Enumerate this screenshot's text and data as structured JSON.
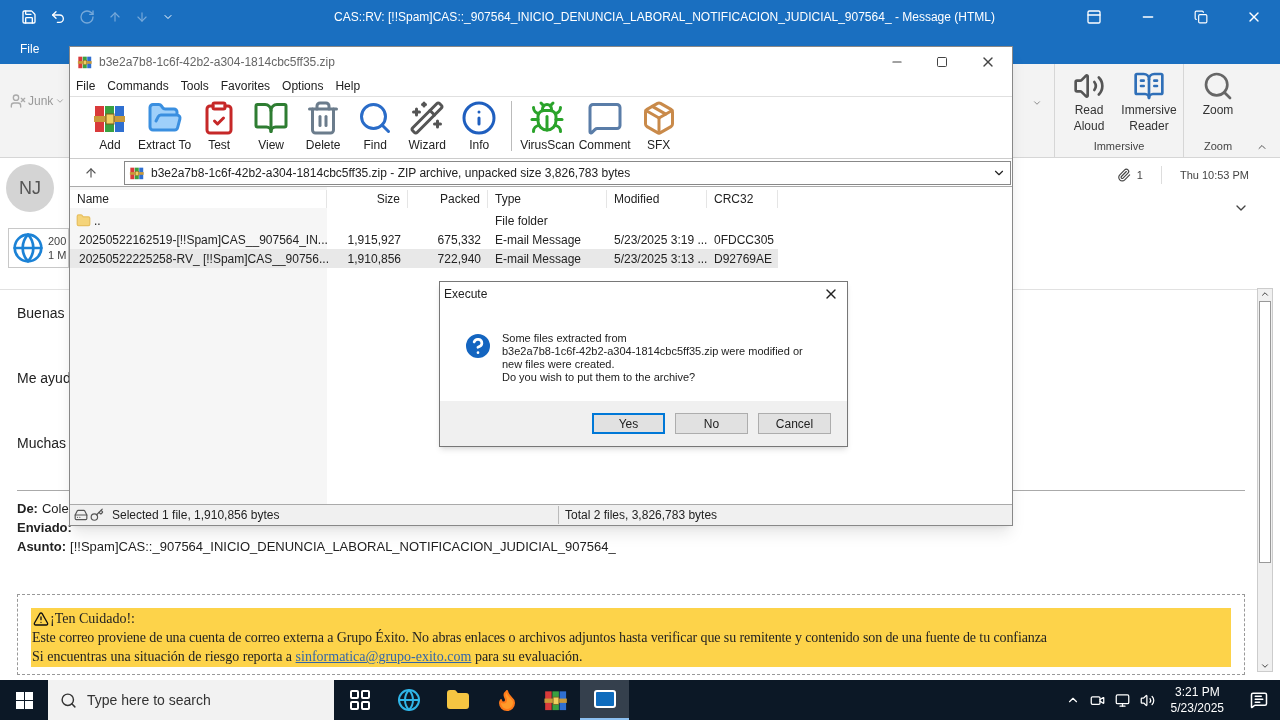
{
  "outlook": {
    "title": "CAS::RV: [!!Spam]CAS::_907564_INICIO_DENUNCIA_LABORAL_NOTIFICACION_JUDICIAL_907564_ - Message (HTML)",
    "tabs": [
      "File"
    ],
    "junk": "Junk",
    "ribbon_groups": [
      {
        "label": "Immersive",
        "buttons": [
          {
            "kind": "read-aloud",
            "label": "Read Aloud"
          },
          {
            "kind": "immersive-reader",
            "label": "Immersive Reader"
          }
        ]
      },
      {
        "label": "Zoom",
        "buttons": [
          {
            "kind": "zoom",
            "label": "Zoom"
          }
        ]
      }
    ],
    "sender_initials": "NJ",
    "attachment_count": "1",
    "received": "Thu 10:53 PM",
    "attachment": {
      "name": "200",
      "size": "1 M"
    },
    "body_lines": [
      "Buenas",
      "Me ayud",
      "Muchas"
    ],
    "headers": [
      {
        "label": "De:",
        "value": "Cole"
      },
      {
        "label": "Enviado:"
      },
      {
        "label": "Asunto:",
        "value": "[!!Spam]CAS::_907564_INICIO_DENUNCIA_LABORAL_NOTIFICACION_JUDICIAL_907564_"
      }
    ],
    "warning": {
      "title": "¡Ten Cuidado!:",
      "text": "Este correo proviene de una cuenta de correo externa a Grupo Éxito. No abras enlaces o archivos adjuntos hasta verificar que su remitente y contenido son de una fuente de tu confianza",
      "report_before": "Si encuentras una situación de riesgo reporta a",
      "report_link": "sinformatica@grupo-exito.com",
      "report_after": "para su evaluación."
    }
  },
  "winrar": {
    "title": "b3e2a7b8-1c6f-42b2-a304-1814cbc5ff35.zip",
    "menu": [
      "File",
      "Commands",
      "Tools",
      "Favorites",
      "Options",
      "Help"
    ],
    "toolbar": [
      {
        "kind": "add",
        "label": "Add",
        "separated": false
      },
      {
        "kind": "extract",
        "label": "Extract To",
        "separated": false
      },
      {
        "kind": "test",
        "label": "Test",
        "separated": false
      },
      {
        "kind": "view",
        "label": "View",
        "separated": false
      },
      {
        "kind": "delete",
        "label": "Delete",
        "separated": false
      },
      {
        "kind": "find",
        "label": "Find",
        "separated": false
      },
      {
        "kind": "wizard",
        "label": "Wizard",
        "separated": false
      },
      {
        "kind": "info",
        "label": "Info",
        "separated": false
      },
      {
        "kind": "virusscan",
        "label": "VirusScan",
        "separated": true
      },
      {
        "kind": "comment",
        "label": "Comment",
        "separated": false
      },
      {
        "kind": "sfx",
        "label": "SFX",
        "separated": false
      }
    ],
    "path": "b3e2a7b8-1c6f-42b2-a304-1814cbc5ff35.zip - ZIP archive, unpacked size 3,826,783 bytes",
    "columns": [
      "Name",
      "Size",
      "Packed",
      "Type",
      "Modified",
      "CRC32"
    ],
    "files": [
      {
        "kind": "folder",
        "name": "..",
        "type": "File folder",
        "selected": false
      },
      {
        "kind": "email",
        "name": "20250522162519-[!!Spam]CAS__907564_IN...",
        "size": "1,915,927",
        "packed": "675,332",
        "type": "E-mail Message",
        "modified": "5/23/2025 3:19 ...",
        "crc": "0FDCC305",
        "selected": false
      },
      {
        "kind": "email",
        "name": "20250522225258-RV_ [!!Spam]CAS__90756...",
        "size": "1,910,856",
        "packed": "722,940",
        "type": "E-mail Message",
        "modified": "5/23/2025 3:13 ...",
        "crc": "D92769AE",
        "selected": true
      }
    ],
    "status_left": "Selected 1 file, 1,910,856 bytes",
    "status_right": "Total 2 files, 3,826,783 bytes"
  },
  "dialog": {
    "title": "Execute",
    "message": [
      "Some files extracted from",
      "b3e2a7b8-1c6f-42b2-a304-1814cbc5ff35.zip were modified or",
      "new files were created.",
      "Do you wish to put them to the archive?"
    ],
    "buttons": [
      {
        "label": "Yes",
        "focused": true
      },
      {
        "label": "No",
        "focused": false
      },
      {
        "label": "Cancel",
        "focused": false
      }
    ]
  },
  "taskbar": {
    "search_placeholder": "Type here to search",
    "apps": [
      {
        "kind": "task-view",
        "active": false
      },
      {
        "kind": "edge",
        "active": false
      },
      {
        "kind": "explorer",
        "active": false
      },
      {
        "kind": "firefox",
        "active": false
      },
      {
        "kind": "winrar",
        "active": false
      },
      {
        "kind": "outlook",
        "active": true
      }
    ],
    "time": "3:21 PM",
    "date": "5/23/2025"
  }
}
